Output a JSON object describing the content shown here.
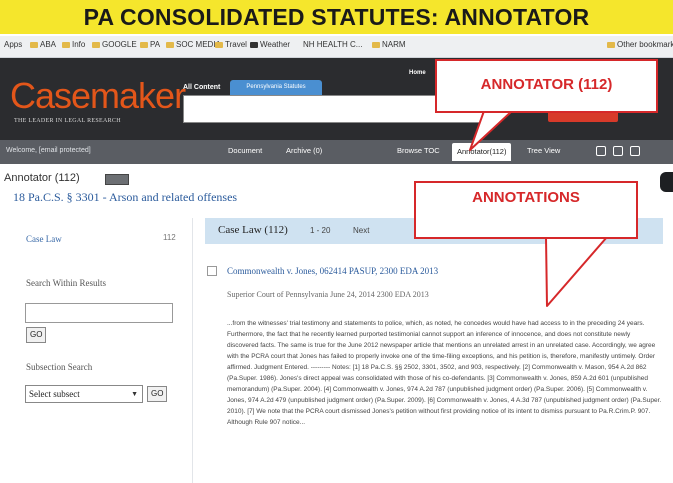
{
  "banner": {
    "title": "PA CONSOLIDATED STATUTES: ANNOTATOR"
  },
  "bookmarks": [
    {
      "label": "Apps"
    },
    {
      "label": "ABA"
    },
    {
      "label": "Info"
    },
    {
      "label": "GOOGLE"
    },
    {
      "label": "PA"
    },
    {
      "label": "SOC MEDIA"
    },
    {
      "label": "Travel"
    },
    {
      "label": "Weather"
    },
    {
      "label": "NH HEALTH C..."
    },
    {
      "label": "NARM"
    },
    {
      "label": "Other bookmarks"
    }
  ],
  "header": {
    "logo": "Casemaker",
    "tagline": "THE LEADER IN LEGAL RESEARCH",
    "tab_all": "All Content",
    "tab_pa": "Pennsylvania Statutes",
    "home": "Home",
    "search_value": ""
  },
  "navbar": {
    "welcome": "Welcome, [email protected]",
    "items": [
      {
        "label": "Document"
      },
      {
        "label": "Archive (0)"
      },
      {
        "label": "Browse TOC"
      },
      {
        "label": "Annotator(112)"
      },
      {
        "label": "Tree View"
      }
    ]
  },
  "page": {
    "annotator_title": "Annotator (112)",
    "statute": "18 Pa.C.S. § 3301 - Arson and related offenses"
  },
  "left_panel": {
    "case_law_label": "Case Law",
    "case_law_count": "112",
    "search_within_label": "Search Within Results",
    "search_within_value": "",
    "go_label": "GO",
    "subsection_label": "Subsection Search",
    "select_value": "Select subsect",
    "go2_label": "GO"
  },
  "results": {
    "title": "Case Law (112)",
    "range": "1 - 20",
    "next": "Next",
    "case_title": "Commonwealth v. Jones, 062414 PASUP, 2300 EDA 2013",
    "court_line": "Superior Court of Pennsylvania    June 24, 2014    2300 EDA 2013",
    "excerpt": "...from the witnesses' trial testimony and statements to police, which, as noted, he concedes would have had access to in the preceding 24 years. Furthermore, the fact that he recently learned purported testimonial cannot support an inference of innocence, and does not constitute newly discovered facts. The same is true for the June 2012 newspaper article that mentions an unrelated arrest in an unrelated case. Accordingly, we agree with the PCRA court that Jones has failed to properly invoke one of the time-filing exceptions, and his petition is, therefore, manifestly untimely. Order affirmed. Judgment Entered. --------- Notes: [1] 18 Pa.C.S. §§ 2502, 3301, 3502, and 903, respectively. [2] Commonwealth v. Mason, 954 A.2d 862 (Pa.Super. 1986). Jones's direct appeal was consolidated with those of his co-defendants. [3] Commonwealth v. Jones, 859 A.2d 601 (unpublished memorandum) (Pa.Super. 2004). [4] Commonwealth v. Jones, 974 A.2d 787 (unpublished judgment order) (Pa.Super. 2006). [5] Commonwealth v. Jones, 974 A.2d 479 (unpublished judgment order) (Pa.Super. 2009). [6] Commonwealth v. Jones, 4 A.3d 787 (unpublished judgment order) (Pa.Super. 2010). [7] We note that the PCRA court dismissed Jones's petition without first providing notice of its intent to dismiss pursuant to Pa.R.Crim.P. 907. Although Rule 907 notice..."
  },
  "callouts": {
    "annotator": "ANNOTATOR (112)",
    "annotations": "ANNOTATIONS"
  },
  "colors": {
    "banner": "#f5e62c",
    "logo": "#e3561a",
    "callout": "#d6282a",
    "link": "#2b5b9c",
    "results_header": "#cfe2f1"
  }
}
